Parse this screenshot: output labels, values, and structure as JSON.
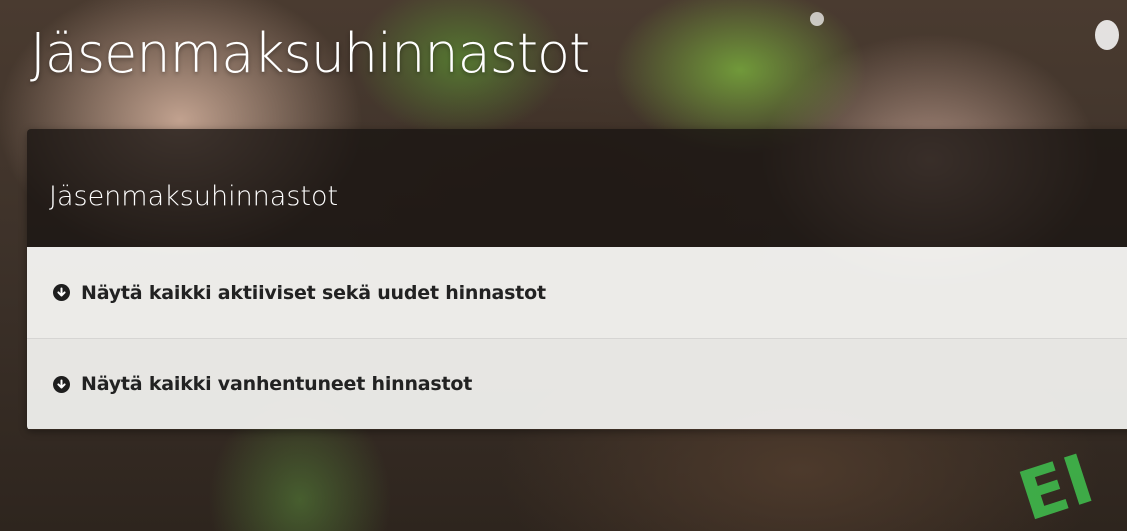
{
  "page": {
    "title": "Jäsenmaksuhinnastot"
  },
  "panel": {
    "title": "Jäsenmaksuhinnastot",
    "items": [
      {
        "label": "Näytä kaikki aktiiviset sekä uudet hinnastot",
        "icon": "circle-arrow-down-icon"
      },
      {
        "label": "Näytä kaikki vanhentuneet hinnastot",
        "icon": "circle-arrow-down-icon"
      }
    ]
  },
  "background": {
    "logo_text": "EI"
  },
  "colors": {
    "header_bg": "#191412",
    "item_bg": "#fafaf8",
    "icon_bg": "#1e1e1e",
    "logo_green": "#3fb24a"
  }
}
